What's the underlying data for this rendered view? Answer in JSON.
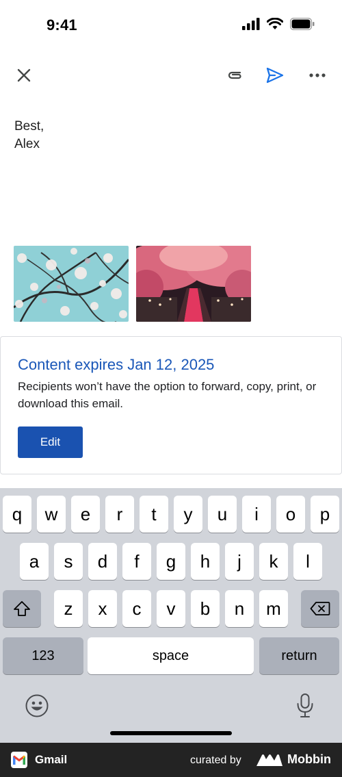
{
  "status_bar": {
    "time": "9:41"
  },
  "toolbar": {
    "close_icon": "close-icon",
    "attach_icon": "paperclip-icon",
    "send_icon": "send-icon",
    "more_icon": "more-horizontal-icon",
    "accent": "#1a73e8"
  },
  "body": {
    "line1": "Best,",
    "line2": "Alex"
  },
  "attachments": [
    {
      "icon": "image-attachment",
      "subject": "cherry blossom branches against sky"
    },
    {
      "icon": "image-attachment",
      "subject": "cherry blossom canal at night"
    }
  ],
  "expiry": {
    "title": "Content expires Jan 12, 2025",
    "description": "Recipients won’t have the option to forward, copy, print, or download this email.",
    "edit_label": "Edit",
    "title_color": "#1a57b8",
    "button_color": "#1a52b0"
  },
  "keyboard": {
    "row1": [
      "q",
      "w",
      "e",
      "r",
      "t",
      "y",
      "u",
      "i",
      "o",
      "p"
    ],
    "row2": [
      "a",
      "s",
      "d",
      "f",
      "g",
      "h",
      "j",
      "k",
      "l"
    ],
    "row3": [
      "z",
      "x",
      "c",
      "v",
      "b",
      "n",
      "m"
    ],
    "numbers_label": "123",
    "space_label": "space",
    "return_label": "return"
  },
  "footer": {
    "app_name": "Gmail",
    "curated_by": "curated by",
    "brand": "Mobbin"
  }
}
